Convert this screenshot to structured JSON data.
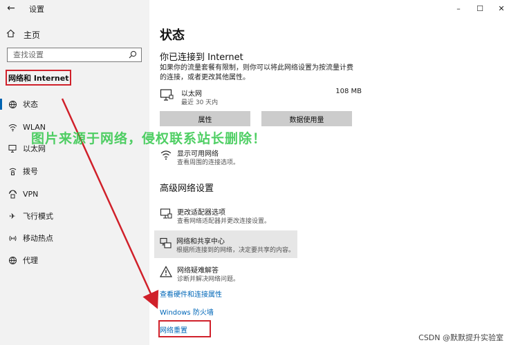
{
  "window": {
    "app_title": "设置",
    "controls": {
      "minimize": "–",
      "maximize": "☐",
      "close": "✕"
    }
  },
  "sidebar": {
    "home_label": "主页",
    "search_placeholder": "查找设置",
    "section_title": "网络和 Internet",
    "items": [
      {
        "label": "状态",
        "icon": "status-icon",
        "active": true
      },
      {
        "label": "WLAN",
        "icon": "wifi-icon"
      },
      {
        "label": "以太网",
        "icon": "ethernet-icon"
      },
      {
        "label": "拨号",
        "icon": "dialup-icon"
      },
      {
        "label": "VPN",
        "icon": "vpn-icon"
      },
      {
        "label": "飞行模式",
        "icon": "airplane-icon"
      },
      {
        "label": "移动热点",
        "icon": "hotspot-icon"
      },
      {
        "label": "代理",
        "icon": "proxy-icon"
      }
    ]
  },
  "main": {
    "page_title": "状态",
    "connected_heading": "你已连接到 Internet",
    "connected_desc": "如果你的流量套餐有限制，则你可以将此网络设置为按流量计费的连接，或者更改其他属性。",
    "connection": {
      "name": "以太网",
      "sub": "最近 30 天内",
      "usage": "108 MB"
    },
    "buttons": {
      "properties": "属性",
      "data_usage": "数据使用量"
    },
    "show_networks": {
      "title": "显示可用网络",
      "desc": "查看周围的连接选项。"
    },
    "advanced_heading": "高级网络设置",
    "adapter_options": {
      "title": "更改适配器选项",
      "desc": "查看网络适配器并更改连接设置。"
    },
    "sharing_center": {
      "title": "网络和共享中心",
      "desc": "根据所连接到的网络，决定要共享的内容。"
    },
    "troubleshooter": {
      "title": "网络疑难解答",
      "desc": "诊断并解决网络问题。"
    },
    "links": {
      "hardware": "查看硬件和连接属性",
      "firewall": "Windows 防火墙",
      "reset": "网络重置"
    }
  },
  "overlay": {
    "watermark": "图片来源于网络，侵权联系站长删除！",
    "credit": "CSDN @默默提升实验室",
    "annotation_color": "#d0202a",
    "watermark_color": "#31c74a"
  }
}
